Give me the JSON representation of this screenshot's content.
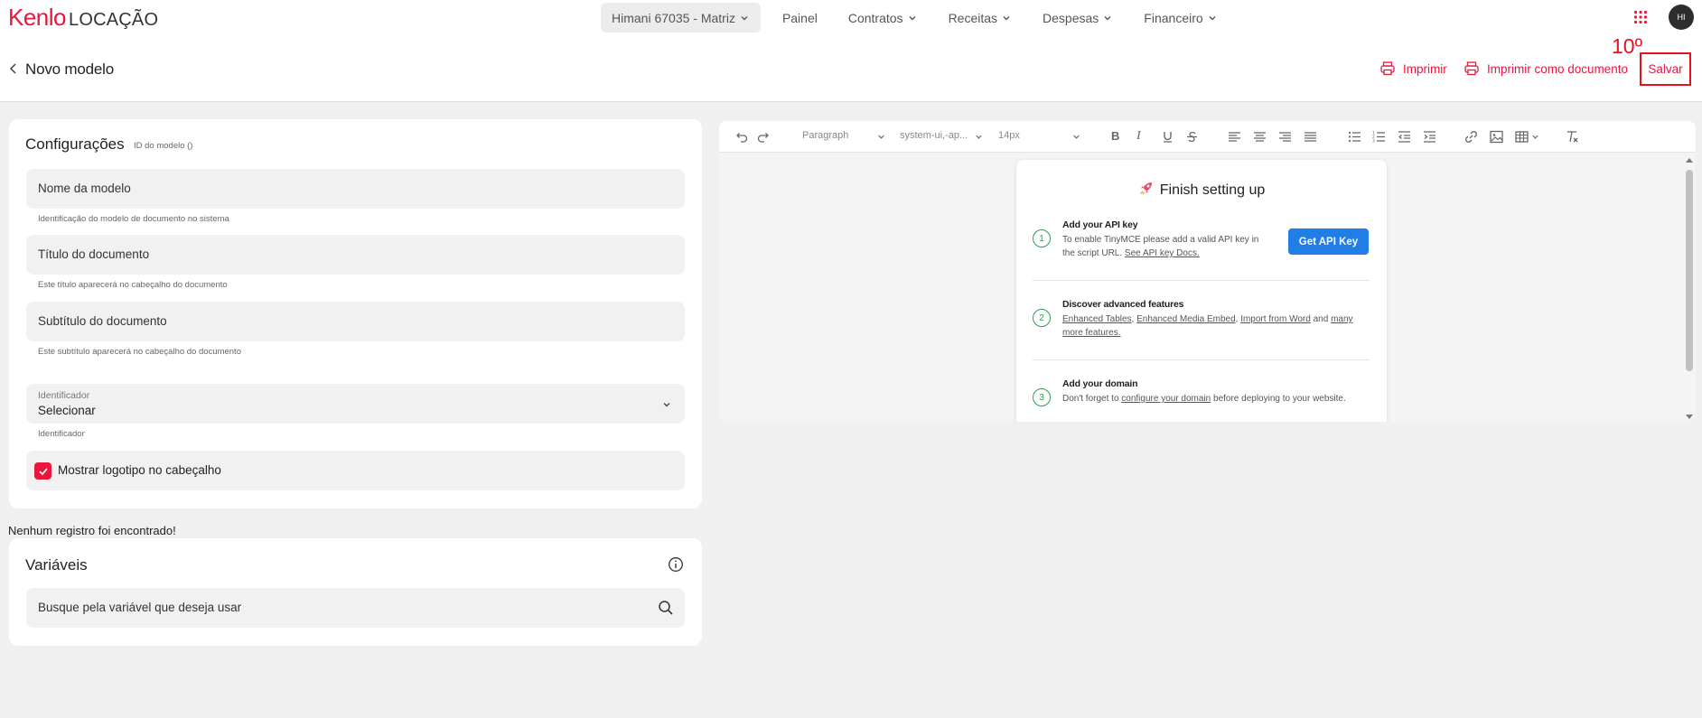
{
  "brand": {
    "name": "Kenlo",
    "product": "LOCAÇÃO",
    "accent": "#e8173b"
  },
  "nav": {
    "branch": "Himani 67035 - Matriz",
    "items": [
      {
        "label": "Painel",
        "has_menu": false
      },
      {
        "label": "Contratos",
        "has_menu": true
      },
      {
        "label": "Receitas",
        "has_menu": true
      },
      {
        "label": "Despesas",
        "has_menu": true
      },
      {
        "label": "Financeiro",
        "has_menu": true
      }
    ],
    "avatar_initials": "HI"
  },
  "header": {
    "title": "Novo modelo",
    "print_label": "Imprimir",
    "print_doc_label": "Imprimir como documento",
    "save_label": "Salvar",
    "step_annotation": "10º"
  },
  "config": {
    "title": "Configurações",
    "id_label": "ID do modelo ()",
    "name_field": {
      "label": "Nome da modelo",
      "hint": "Identificação do modelo de documento no sistema"
    },
    "title_field": {
      "label": "Título do documento",
      "hint": "Este título aparecerá no cabeçalho do documento"
    },
    "subtitle_field": {
      "label": "Subtítulo do documento",
      "hint": "Este subtítulo aparecerá no cabeçalho do documento"
    },
    "identifier": {
      "label": "Identificador",
      "value": "Selecionar",
      "hint": "Identificador"
    },
    "logo_checkbox": {
      "label": "Mostrar logotipo no cabeçalho",
      "checked": true
    }
  },
  "empty_message": "Nenhum registro foi encontrado!",
  "variables": {
    "title": "Variáveis",
    "search_placeholder": "Busque pela variável que deseja usar"
  },
  "editor": {
    "toolbar": {
      "block_format": "Paragraph",
      "font_family": "system-ui,-ap...",
      "font_size": "14px"
    },
    "panel": {
      "title": "Finish setting up",
      "icon": "rocket-icon",
      "steps": [
        {
          "num": "1",
          "title": "Add your API key",
          "desc_1": "To enable TinyMCE please add a valid API key in",
          "desc_2": "the script URL.",
          "link": "See API key Docs."
        },
        {
          "num": "2",
          "title": "Discover advanced features",
          "link_1": "Enhanced Tables",
          "link_2": "Enhanced Media Embed",
          "link_3": "Import from Word",
          "and": "and",
          "link_4": "many",
          "link_5": "more features."
        },
        {
          "num": "3",
          "title": "Add your domain",
          "desc_1": "Don't forget to",
          "link": "configure your domain",
          "desc_2": "before deploying to your website."
        }
      ],
      "api_button": "Get API Key"
    }
  }
}
